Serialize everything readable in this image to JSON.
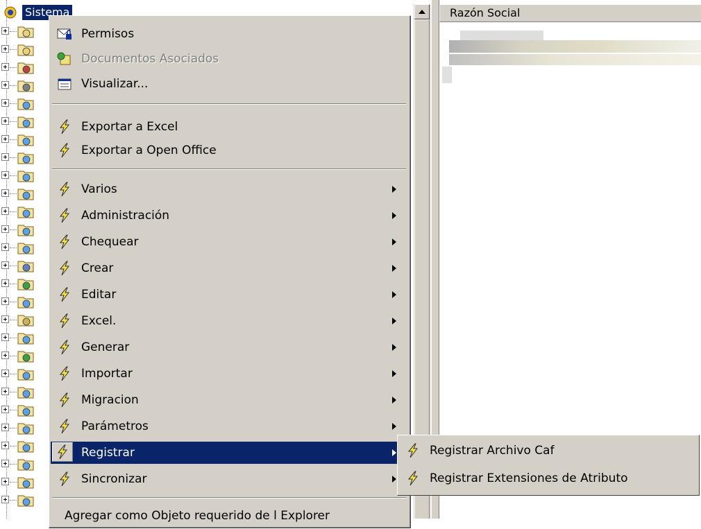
{
  "tree": {
    "root_label": "Sistema",
    "row_count": 27
  },
  "list": {
    "column_header": "Razón Social"
  },
  "context_menu": {
    "items": [
      {
        "label": "Permisos",
        "icon": "envelope-lock-icon",
        "disabled": false,
        "submenu": false
      },
      {
        "label": "Documentos Asociados",
        "icon": "attach-icon",
        "disabled": true,
        "submenu": false
      },
      {
        "label": "Visualizar...",
        "icon": "properties-icon",
        "disabled": false,
        "submenu": false
      },
      {
        "label": "Exportar a Excel",
        "icon": "lightning-icon",
        "disabled": false,
        "submenu": false
      },
      {
        "label": "Exportar a Open Office",
        "icon": "lightning-icon",
        "disabled": false,
        "submenu": false
      },
      {
        "label": "Varios",
        "icon": "lightning-icon",
        "disabled": false,
        "submenu": true
      },
      {
        "label": "Administración",
        "icon": "lightning-icon",
        "disabled": false,
        "submenu": true
      },
      {
        "label": "Chequear",
        "icon": "lightning-icon",
        "disabled": false,
        "submenu": true
      },
      {
        "label": "Crear",
        "icon": "lightning-icon",
        "disabled": false,
        "submenu": true
      },
      {
        "label": "Editar",
        "icon": "lightning-icon",
        "disabled": false,
        "submenu": true
      },
      {
        "label": "Excel.",
        "icon": "lightning-icon",
        "disabled": false,
        "submenu": true
      },
      {
        "label": "Generar",
        "icon": "lightning-icon",
        "disabled": false,
        "submenu": true
      },
      {
        "label": "Importar",
        "icon": "lightning-icon",
        "disabled": false,
        "submenu": true
      },
      {
        "label": "Migracion",
        "icon": "lightning-icon",
        "disabled": false,
        "submenu": true
      },
      {
        "label": "Parámetros",
        "icon": "lightning-icon",
        "disabled": false,
        "submenu": true
      },
      {
        "label": "Registrar",
        "icon": "lightning-icon",
        "disabled": false,
        "submenu": true,
        "highlighted": true
      },
      {
        "label": "Sincronizar",
        "icon": "lightning-icon",
        "disabled": false,
        "submenu": true
      },
      {
        "label": "Agregar como Objeto requerido de l Explorer",
        "icon": "",
        "disabled": false,
        "submenu": false
      }
    ]
  },
  "submenu": {
    "items": [
      {
        "label": "Registrar Archivo Caf",
        "icon": "lightning-icon"
      },
      {
        "label": "Registrar Extensiones de Atributo",
        "icon": "lightning-icon"
      }
    ]
  },
  "colors": {
    "menu_bg": "#d4d0c8",
    "highlight": "#0a246a",
    "disabled_text": "#808080"
  }
}
